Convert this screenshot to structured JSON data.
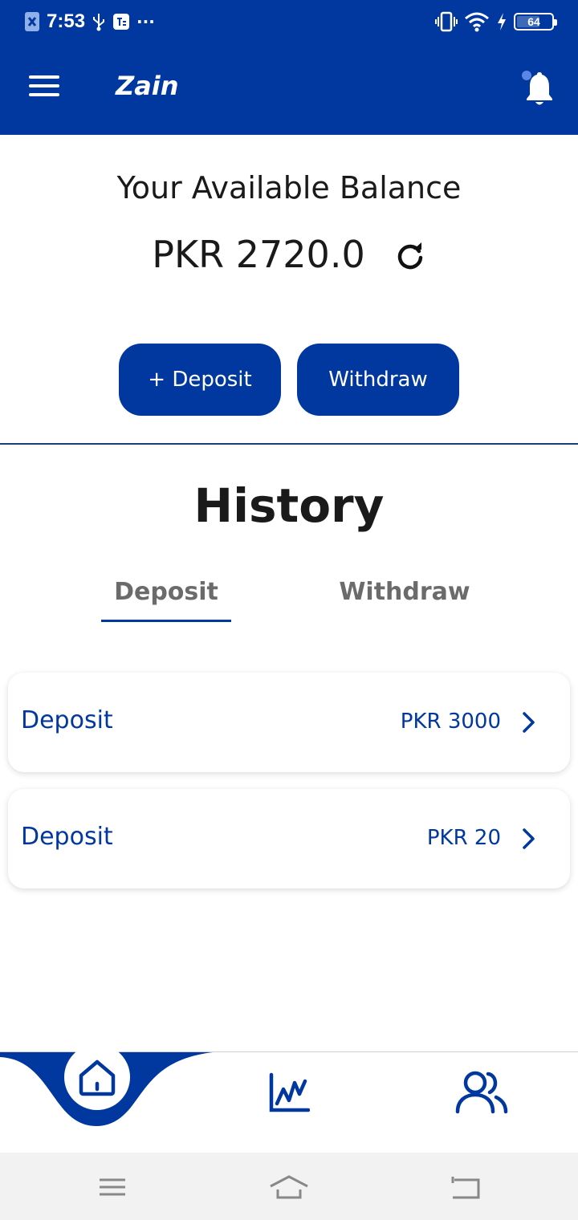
{
  "status_bar": {
    "time": "7:53",
    "more": "···",
    "battery": "64"
  },
  "app_bar": {
    "title": "Zain"
  },
  "balance": {
    "title": "Your Available Balance",
    "amount": "PKR 2720.0"
  },
  "actions": {
    "deposit_label": "+ Deposit",
    "withdraw_label": "Withdraw"
  },
  "history": {
    "title": "History",
    "tabs": [
      {
        "label": "Deposit",
        "active": true
      },
      {
        "label": "Withdraw",
        "active": false
      }
    ],
    "items": [
      {
        "label": "Deposit",
        "amount": "PKR 3000"
      },
      {
        "label": "Deposit",
        "amount": "PKR 20"
      }
    ]
  },
  "colors": {
    "primary": "#0038A0",
    "text_dark": "#1a1a1a",
    "tab_inactive": "#6b6b6b",
    "notification_dot": "#5B86E5"
  },
  "icons": {
    "menu": "hamburger-icon",
    "notifications": "bell-icon",
    "refresh": "refresh-icon",
    "chevron": "chevron-right-icon",
    "nav_home": "home-icon",
    "nav_stats": "chart-icon",
    "nav_team": "users-icon"
  }
}
